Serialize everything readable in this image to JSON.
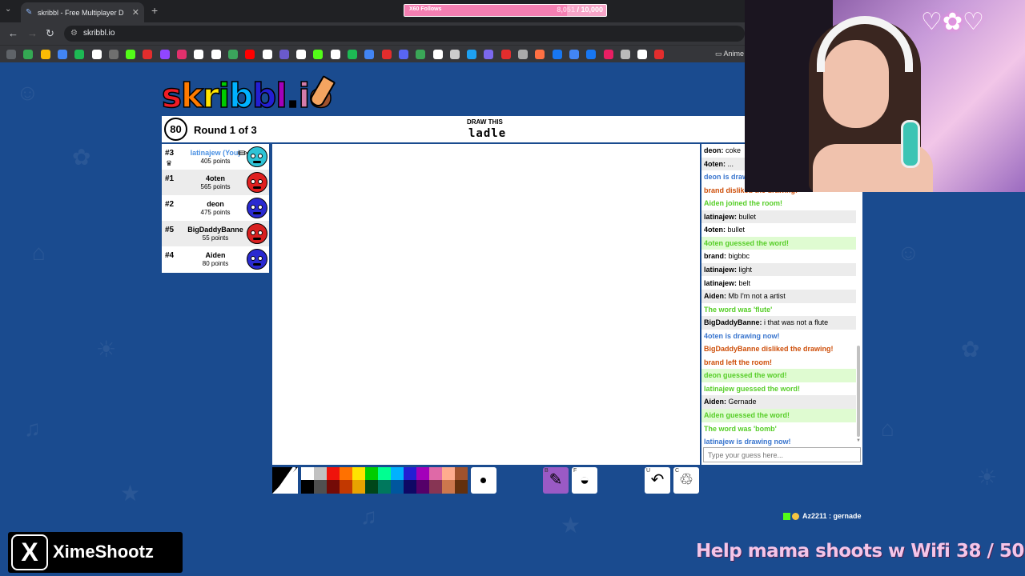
{
  "browser": {
    "tab_title": "skribbl - Free Multiplayer D",
    "url": "skribbl.io",
    "bookmark_folder": "Anime"
  },
  "overlay": {
    "follows_label": "X60 Follows",
    "follows_current": "8,051",
    "follows_goal": "/ 10,000",
    "follows_progress": 0.805,
    "twitter_handle": "XimeShootz",
    "chat_line": "Az2211 : gernade",
    "goal_text": "Help mama shoots w Wifi  38 / 50"
  },
  "game": {
    "logo": [
      "s",
      "k",
      "r",
      "i",
      "b",
      "b",
      "l",
      ".",
      "i",
      "o"
    ],
    "logo_colors": [
      "#ef1c25",
      "#ff7a00",
      "#ffe400",
      "#00cc00",
      "#00b2ff",
      "#231fd3",
      "#a300ba",
      "#000000",
      "#d37caa",
      "#a0522d"
    ],
    "timer": "80",
    "round": "Round 1 of 3",
    "draw_label": "DRAW THIS",
    "word": "ladle",
    "players": [
      {
        "rank": "#3",
        "name": "latinajew (You)",
        "points": "405 points",
        "me": true,
        "color": "#2ec3d6",
        "crown": "♛",
        "drawing": true
      },
      {
        "rank": "#1",
        "name": "4oten",
        "points": "565 points",
        "me": false,
        "color": "#e02020"
      },
      {
        "rank": "#2",
        "name": "deon",
        "points": "475 points",
        "me": false,
        "color": "#2a2ad0"
      },
      {
        "rank": "#5",
        "name": "BigDaddyBanne",
        "points": "55 points",
        "me": false,
        "color": "#d82020"
      },
      {
        "rank": "#4",
        "name": "Aiden",
        "points": "80 points",
        "me": false,
        "color": "#2a2ad0"
      }
    ],
    "chat": [
      {
        "user": "deon",
        "text": "coke",
        "style": "plain"
      },
      {
        "user": "4oten",
        "text": "...",
        "style": "alt"
      },
      {
        "user": "",
        "text": "deon is drawing now!",
        "style": "blue"
      },
      {
        "user": "",
        "text": "brand disliked the drawing!",
        "style": "orange"
      },
      {
        "user": "",
        "text": "Aiden joined the room!",
        "style": "green"
      },
      {
        "user": "latinajew",
        "text": "bullet",
        "style": "alt"
      },
      {
        "user": "4oten",
        "text": "bullet",
        "style": "plain"
      },
      {
        "user": "",
        "text": "4oten guessed the word!",
        "style": "greenbg"
      },
      {
        "user": "brand",
        "text": "bigbbc",
        "style": "plain"
      },
      {
        "user": "latinajew",
        "text": "light",
        "style": "alt"
      },
      {
        "user": "latinajew",
        "text": "belt",
        "style": "plain"
      },
      {
        "user": "Aiden",
        "text": "Mb I'm not a artist",
        "style": "alt"
      },
      {
        "user": "",
        "text": "The word was 'flute'",
        "style": "green"
      },
      {
        "user": "BigDaddyBanne",
        "text": "i that was not a flute",
        "style": "alt"
      },
      {
        "user": "",
        "text": "4oten is drawing now!",
        "style": "blue"
      },
      {
        "user": "",
        "text": "BigDaddyBanne disliked the drawing!",
        "style": "orange"
      },
      {
        "user": "",
        "text": "brand left the room!",
        "style": "orange"
      },
      {
        "user": "",
        "text": "deon guessed the word!",
        "style": "greenbg"
      },
      {
        "user": "",
        "text": "latinajew guessed the word!",
        "style": "green"
      },
      {
        "user": "Aiden",
        "text": "Gernade",
        "style": "alt"
      },
      {
        "user": "",
        "text": "Aiden guessed the word!",
        "style": "greenbg"
      },
      {
        "user": "",
        "text": "The word was 'bomb'",
        "style": "green"
      },
      {
        "user": "",
        "text": "latinajew is drawing now!",
        "style": "blue"
      }
    ],
    "chat_placeholder": "Type your guess here...",
    "palette_top": [
      "#ffffff",
      "#c1c1c1",
      "#ef130b",
      "#ff7100",
      "#ffe400",
      "#00cc00",
      "#00ff91",
      "#00b2ff",
      "#231fd3",
      "#a300ba",
      "#df69a7",
      "#ffac8e",
      "#a0522d"
    ],
    "palette_bottom": [
      "#000000",
      "#505050",
      "#740b07",
      "#c23800",
      "#e8a200",
      "#004619",
      "#00785d",
      "#00569e",
      "#0e0865",
      "#550069",
      "#873554",
      "#cc774d",
      "#63300d"
    ],
    "tools": [
      {
        "name": "pen-tool",
        "key": "B",
        "glyph": "✎",
        "active": true
      },
      {
        "name": "fill-tool",
        "key": "F",
        "glyph": "◒",
        "active": false
      },
      {
        "name": "undo-button",
        "key": "U",
        "glyph": "↶",
        "active": false
      },
      {
        "name": "clear-button",
        "key": "C",
        "glyph": "♲",
        "active": false
      }
    ]
  }
}
